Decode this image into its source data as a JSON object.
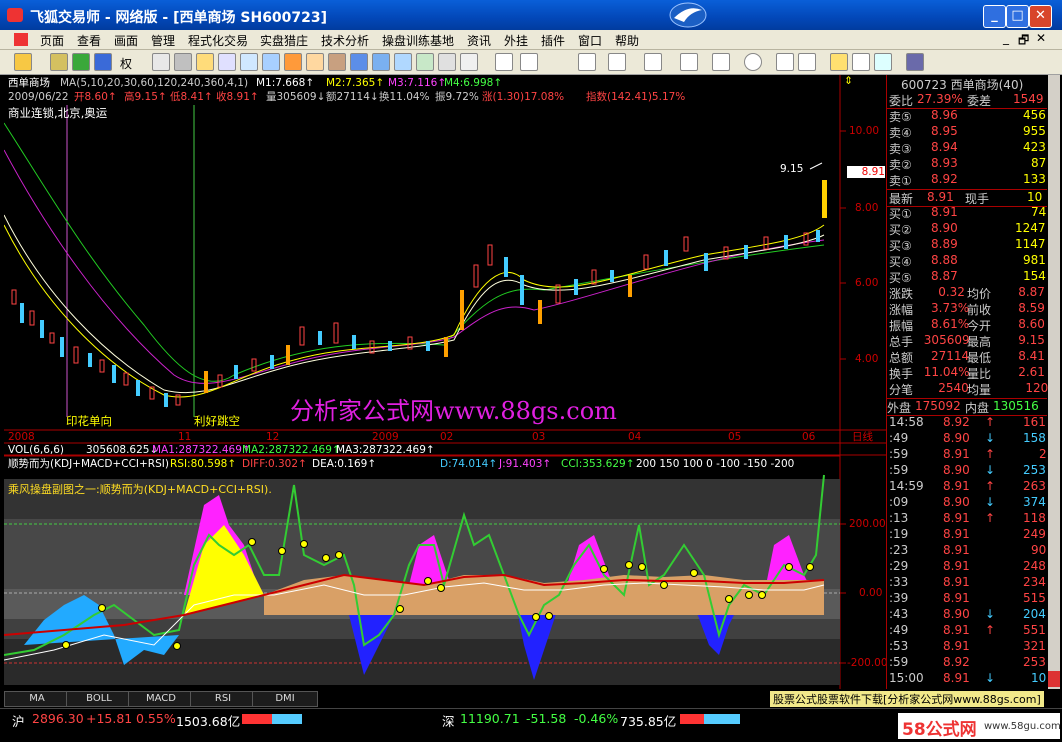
{
  "window": {
    "title": "飞狐交易师 - 网络版 - [西单商场 SH600723]"
  },
  "menu": [
    "页面",
    "查看",
    "画面",
    "管理",
    "程式化交易",
    "实盘猎庄",
    "技术分析",
    "操盘训练基地",
    "资讯",
    "外挂",
    "插件",
    "窗口",
    "帮助"
  ],
  "toolbar": {
    "period_label": "权"
  },
  "main_chart": {
    "title": "西单商场",
    "ma_params": "MA(5,10,20,30,60,120,240,360,4,1)",
    "m1": "M1:7.668↑",
    "m2": "M2:7.365↑",
    "m3": "M3:7.116↑",
    "m4": "M4:6.998↑",
    "info_date": "2009/06/22",
    "info_open": "开8.60↑",
    "info_high": "高9.15↑",
    "info_low": "低8.41↑",
    "info_close": "收8.91↑",
    "info_vol": "量305609↓",
    "info_amt": "额27114↓",
    "info_turn": "换11.04%",
    "info_amp": "振9.72%",
    "info_chg": "涨(1.30)17.08%",
    "info_idx": "指数(142.41)5.17%",
    "sector": "商业连锁,北京,奥运",
    "peak_label": "9.15",
    "price_tag": "8.91",
    "y_ticks": [
      "10.00",
      "8.00",
      "6.00",
      "4.00"
    ],
    "event_1": "印花单向",
    "event_2": "利好跳空",
    "dates": [
      "2008",
      "11",
      "12",
      "2009",
      "02",
      "03",
      "04",
      "05",
      "06",
      "日线"
    ],
    "watermark": "分析家公式网www.88gs.com"
  },
  "vol": {
    "header": "VOL(6,6,6)",
    "v": "305608.625↓",
    "ma1": "MA1:287322.469↑",
    "ma2": "MA2:287322.469↑",
    "ma3": "MA3:287322.469↑"
  },
  "indicator": {
    "name": "顺势而为(KDJ+MACD+CCI+RSI)",
    "rsi": "RSI:80.598↑",
    "diff": "DIFF:0.302↑",
    "dea": "DEA:0.169↑",
    "d": "D:74.014↑",
    "j": "J:91.403↑",
    "cci": "CCI:353.629↑",
    "levels": "200  150  100  0  -100  -150  -200",
    "subtitle": "乘风操盘副图之一:顺势而为(KDJ+MACD+CCI+RSI).",
    "y_ticks": [
      "200.00",
      "0.00",
      "-200.00"
    ]
  },
  "tabs": [
    "MA",
    "BOLL",
    "MACD",
    "RSI",
    "DMI"
  ],
  "panel": {
    "code_name": "600723 西单商场(40)",
    "weibi": "27.39%",
    "weicha_label": "委差",
    "weicha": "1549",
    "weibi_label": "委比",
    "sells": [
      {
        "label": "卖⑤",
        "price": "8.96",
        "vol": "456"
      },
      {
        "label": "卖④",
        "price": "8.95",
        "vol": "955"
      },
      {
        "label": "卖③",
        "price": "8.94",
        "vol": "423"
      },
      {
        "label": "卖②",
        "price": "8.93",
        "vol": "87"
      },
      {
        "label": "卖①",
        "price": "8.92",
        "vol": "133"
      }
    ],
    "last_label": "最新",
    "last": "8.91",
    "now_label": "现手",
    "now": "10",
    "buys": [
      {
        "label": "买①",
        "price": "8.91",
        "vol": "74"
      },
      {
        "label": "买②",
        "price": "8.90",
        "vol": "1247"
      },
      {
        "label": "买③",
        "price": "8.89",
        "vol": "1147"
      },
      {
        "label": "买④",
        "price": "8.88",
        "vol": "981"
      },
      {
        "label": "买⑤",
        "price": "8.87",
        "vol": "154"
      }
    ],
    "stats": [
      [
        "涨跌",
        "0.32",
        "均价",
        "8.87"
      ],
      [
        "涨幅",
        "3.73%",
        "前收",
        "8.59"
      ],
      [
        "振幅",
        "8.61%",
        "今开",
        "8.60"
      ],
      [
        "总手",
        "305609",
        "最高",
        "9.15"
      ],
      [
        "总额",
        "27114",
        "最低",
        "8.41"
      ],
      [
        "换手",
        "11.04%",
        "量比",
        "2.61"
      ],
      [
        "分笔",
        "2540",
        "均量",
        "120"
      ]
    ],
    "waipan_label": "外盘",
    "waipan": "175092",
    "neipan_label": "内盘",
    "neipan": "130516",
    "ticks": [
      [
        "14:58",
        "8.92",
        "↑",
        "161"
      ],
      [
        ":49",
        "8.90",
        "↓",
        "158"
      ],
      [
        ":59",
        "8.91",
        "↑",
        "2"
      ],
      [
        ":59",
        "8.90",
        "↓",
        "253"
      ],
      [
        "14:59",
        "8.91",
        "↑",
        "263"
      ],
      [
        ":09",
        "8.90",
        "↓",
        "374"
      ],
      [
        ":13",
        "8.91",
        "↑",
        "118"
      ],
      [
        ":19",
        "8.91",
        "",
        "249"
      ],
      [
        ":23",
        "8.91",
        "",
        "90"
      ],
      [
        ":29",
        "8.91",
        "",
        "248"
      ],
      [
        ":33",
        "8.91",
        "",
        "234"
      ],
      [
        ":39",
        "8.91",
        "",
        "515"
      ],
      [
        ":43",
        "8.90",
        "↓",
        "204"
      ],
      [
        ":49",
        "8.91",
        "↑",
        "551"
      ],
      [
        ":53",
        "8.91",
        "",
        "321"
      ],
      [
        ":59",
        "8.92",
        "",
        "253"
      ],
      [
        "15:00",
        "8.91",
        "↓",
        "10"
      ]
    ]
  },
  "status": {
    "sh_label": "沪",
    "sh_idx": "2896.30",
    "sh_chg": "+15.81",
    "sh_pct": "0.55%",
    "sh_amt": "1503.68亿",
    "sz_label": "深",
    "sz_idx": "11190.71",
    "sz_chg": "-51.58",
    "sz_pct": "-0.46%",
    "sz_amt": "735.85亿",
    "ad_text": "股票公式股票软件下载[分析家公式网www.88gs.com]",
    "logo": "58公式网",
    "logo_url": "www.58gu.com"
  }
}
